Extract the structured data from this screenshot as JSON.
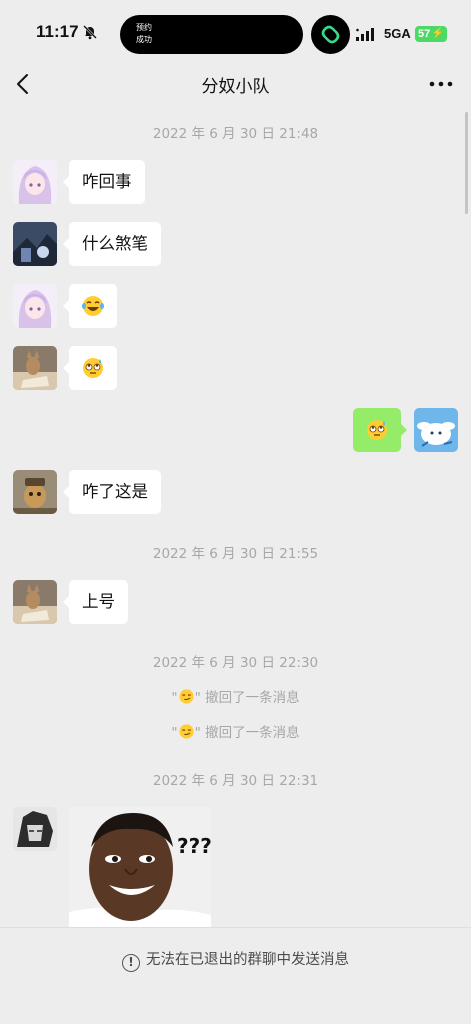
{
  "status_bar": {
    "time": "11:17",
    "island_text_line1": "预约",
    "island_text_line2": "成功",
    "network": "5GA",
    "battery": "57"
  },
  "nav": {
    "title": "分奴小队",
    "back_icon": "chevron-left-icon",
    "more_icon": "more-dots-icon"
  },
  "timestamps": [
    "2022 年 6 月 30 日 21:48",
    "2022 年 6 月 30 日 21:55",
    "2022 年 6 月 30 日 22:30",
    "2022 年 6 月 30 日 22:31"
  ],
  "messages": [
    {
      "side": "left",
      "type": "text",
      "text": "咋回事"
    },
    {
      "side": "left",
      "type": "text",
      "text": "什么煞笔"
    },
    {
      "side": "left",
      "type": "emoji",
      "emoji": "tears-of-joy-emoji"
    },
    {
      "side": "left",
      "type": "emoji",
      "emoji": "sweat-roll-eyes-emoji"
    },
    {
      "side": "right",
      "type": "emoji",
      "emoji": "sweat-roll-eyes-emoji"
    },
    {
      "side": "left",
      "type": "text",
      "text": "咋了这是"
    },
    {
      "side": "left",
      "type": "text",
      "text": "上号"
    },
    {
      "side": "left",
      "type": "sticker",
      "sticker_text": "???"
    }
  ],
  "recalls": [
    {
      "open_quote": "\"",
      "close_quote": "\"",
      "suffix": " 撤回了一条消息"
    },
    {
      "open_quote": "\"",
      "close_quote": "\"",
      "suffix": " 撤回了一条消息"
    }
  ],
  "footer": {
    "notice": "无法在已退出的群聊中发送消息",
    "icon": "info-circle-icon"
  },
  "colors": {
    "background": "#ededed",
    "bubble_received": "#ffffff",
    "bubble_sent": "#95ec69",
    "timestamp": "#a7a7a7"
  }
}
